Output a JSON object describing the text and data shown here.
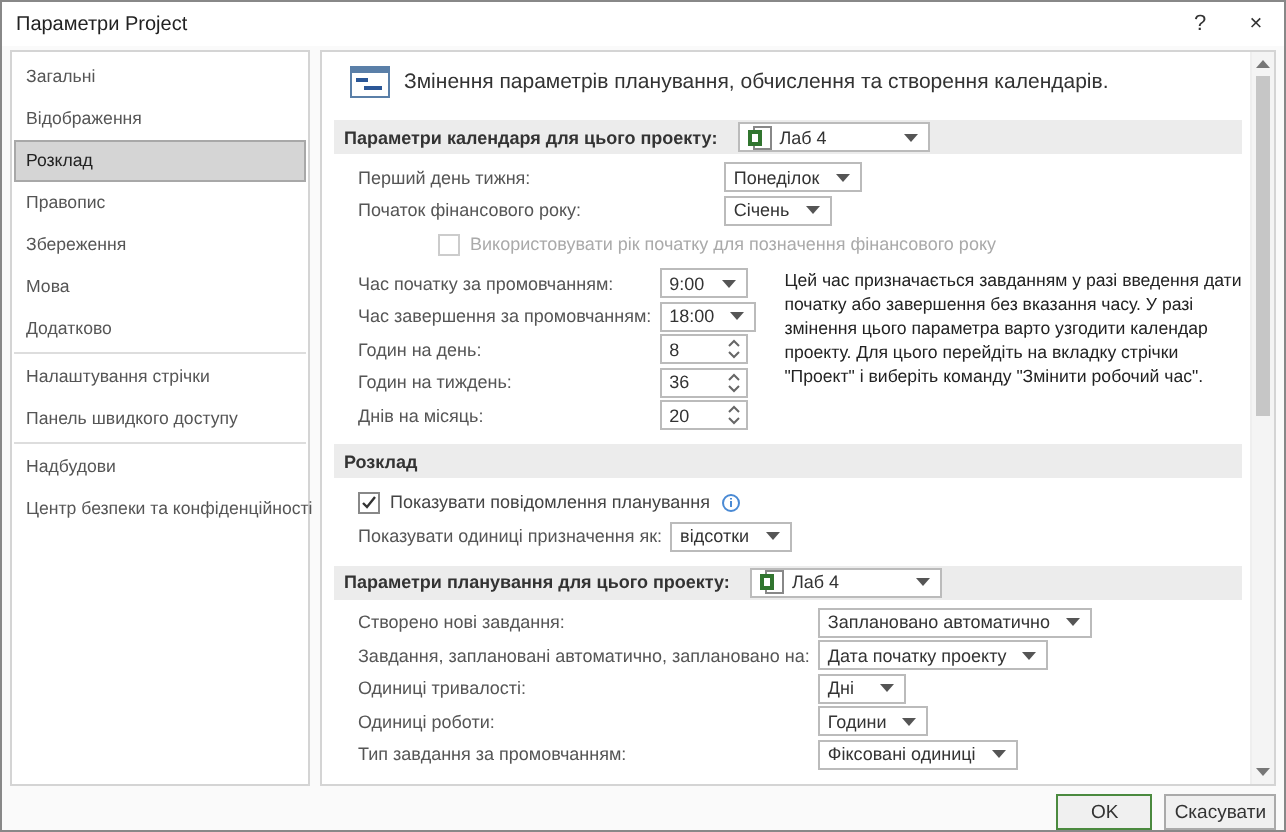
{
  "window": {
    "title": "Параметри Project",
    "help": "?",
    "close": "×"
  },
  "sidebar": {
    "groups": [
      [
        {
          "label": "Загальні",
          "selected": false
        },
        {
          "label": "Відображення",
          "selected": false
        },
        {
          "label": "Розклад",
          "selected": true
        },
        {
          "label": "Правопис",
          "selected": false
        },
        {
          "label": "Збереження",
          "selected": false
        },
        {
          "label": "Мова",
          "selected": false
        },
        {
          "label": "Додатково",
          "selected": false
        }
      ],
      [
        {
          "label": "Налаштування стрічки",
          "selected": false
        },
        {
          "label": "Панель швидкого доступу",
          "selected": false
        }
      ],
      [
        {
          "label": "Надбудови",
          "selected": false
        },
        {
          "label": "Центр безпеки та конфіденційності",
          "selected": false
        }
      ]
    ]
  },
  "content": {
    "heading": "Змінення параметрів планування, обчислення та створення календарів.",
    "sections": [
      {
        "title": "Параметри календаря для цього проекту:",
        "project_select": "Лаб 4",
        "blocks": [
          {
            "rows": [
              {
                "kind": "select",
                "label": "Перший день тижня:",
                "value": "Понеділок"
              },
              {
                "kind": "select",
                "label": "Початок фінансового року:",
                "value": "Січень"
              },
              {
                "kind": "checkbox",
                "label": "Використовувати рік початку для позначення фінансового року",
                "checked": false,
                "disabled": true
              }
            ]
          },
          {
            "rows": [
              {
                "kind": "select",
                "label": "Час початку за промовчанням:",
                "value": "9:00"
              },
              {
                "kind": "select",
                "label": "Час завершення за промовчанням:",
                "value": "18:00"
              },
              {
                "kind": "spin",
                "label": "Годин на день:",
                "value": "8"
              },
              {
                "kind": "spin",
                "label": "Годин на тиждень:",
                "value": "36"
              },
              {
                "kind": "spin",
                "label": "Днів на місяць:",
                "value": "20"
              }
            ],
            "note": "Цей час призначається завданням у разі введення дати початку або завершення без вказання часу. У разі змінення цього параметра варто узгодити календар проекту. Для цього перейдіть на вкладку стрічки \"Проект\" і виберіть команду \"Змінити робочий час\"."
          }
        ]
      },
      {
        "title": "Розклад",
        "blocks": [
          {
            "rows": [
              {
                "kind": "checkbox",
                "label": "Показувати повідомлення планування",
                "checked": true,
                "disabled": false,
                "info": true
              },
              {
                "kind": "select",
                "label": "Показувати одиниці призначення як:",
                "value": "відсотки"
              }
            ]
          }
        ]
      },
      {
        "title": "Параметри планування для цього проекту:",
        "project_select": "Лаб 4",
        "blocks": [
          {
            "rows": [
              {
                "kind": "select",
                "label": "Створено нові завдання:",
                "value": "Заплановано автоматично"
              },
              {
                "kind": "select",
                "label": "Завдання, заплановані автоматично, заплановано на:",
                "value": "Дата початку проекту"
              },
              {
                "kind": "select",
                "label": "Одиниці тривалості:",
                "value": "Дні"
              },
              {
                "kind": "select",
                "label": "Одиниці роботи:",
                "value": "Години"
              },
              {
                "kind": "select",
                "label": "Тип завдання за промовчанням:",
                "value": "Фіксовані одиниці"
              }
            ]
          }
        ]
      }
    ]
  },
  "buttons": [
    {
      "label": "OK",
      "default": true
    },
    {
      "label": "Скасувати",
      "default": false
    }
  ]
}
